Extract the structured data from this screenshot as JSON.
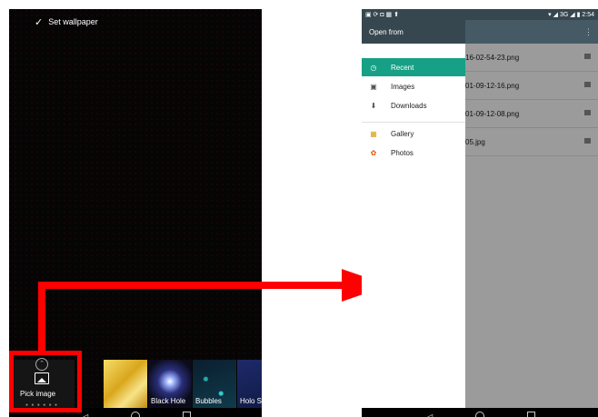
{
  "left_screen": {
    "topbar": {
      "label": "Set wallpaper",
      "check_icon": "check-icon"
    },
    "pick_tile": {
      "label": "Pick image",
      "icon": "image-icon"
    },
    "wallpapers": [
      {
        "label": ""
      },
      {
        "label": "Black Hole"
      },
      {
        "label": "Bubbles"
      },
      {
        "label": "Holo Sp"
      }
    ]
  },
  "right_screen": {
    "statusbar": {
      "left_icons": "▣ ⟳ ◘ ▦ ⬆",
      "right_text": "▾ ◢ 3G ◢ ▮ 2:54"
    },
    "drawer": {
      "title": "Open from",
      "items": [
        {
          "label": "Recent",
          "icon": "clock-icon",
          "glyph": "◷",
          "active": true
        },
        {
          "label": "Images",
          "icon": "image-icon",
          "glyph": "▣"
        },
        {
          "label": "Downloads",
          "icon": "download-icon",
          "glyph": "⬇"
        },
        {
          "label": "Gallery",
          "icon": "gallery-icon",
          "glyph": "▦"
        },
        {
          "label": "Photos",
          "icon": "photos-icon",
          "glyph": "✿"
        }
      ]
    },
    "files": [
      {
        "name": "16-02-54-23.png"
      },
      {
        "name": "01-09-12-16.png"
      },
      {
        "name": "01-09-12-08.png"
      },
      {
        "name": "05.jpg"
      }
    ]
  },
  "navbar": {
    "back": "◁",
    "home": "○",
    "recents": "□"
  },
  "colors": {
    "accent": "#16a085",
    "annotation": "#ff0000",
    "toolbar": "#37474f"
  }
}
